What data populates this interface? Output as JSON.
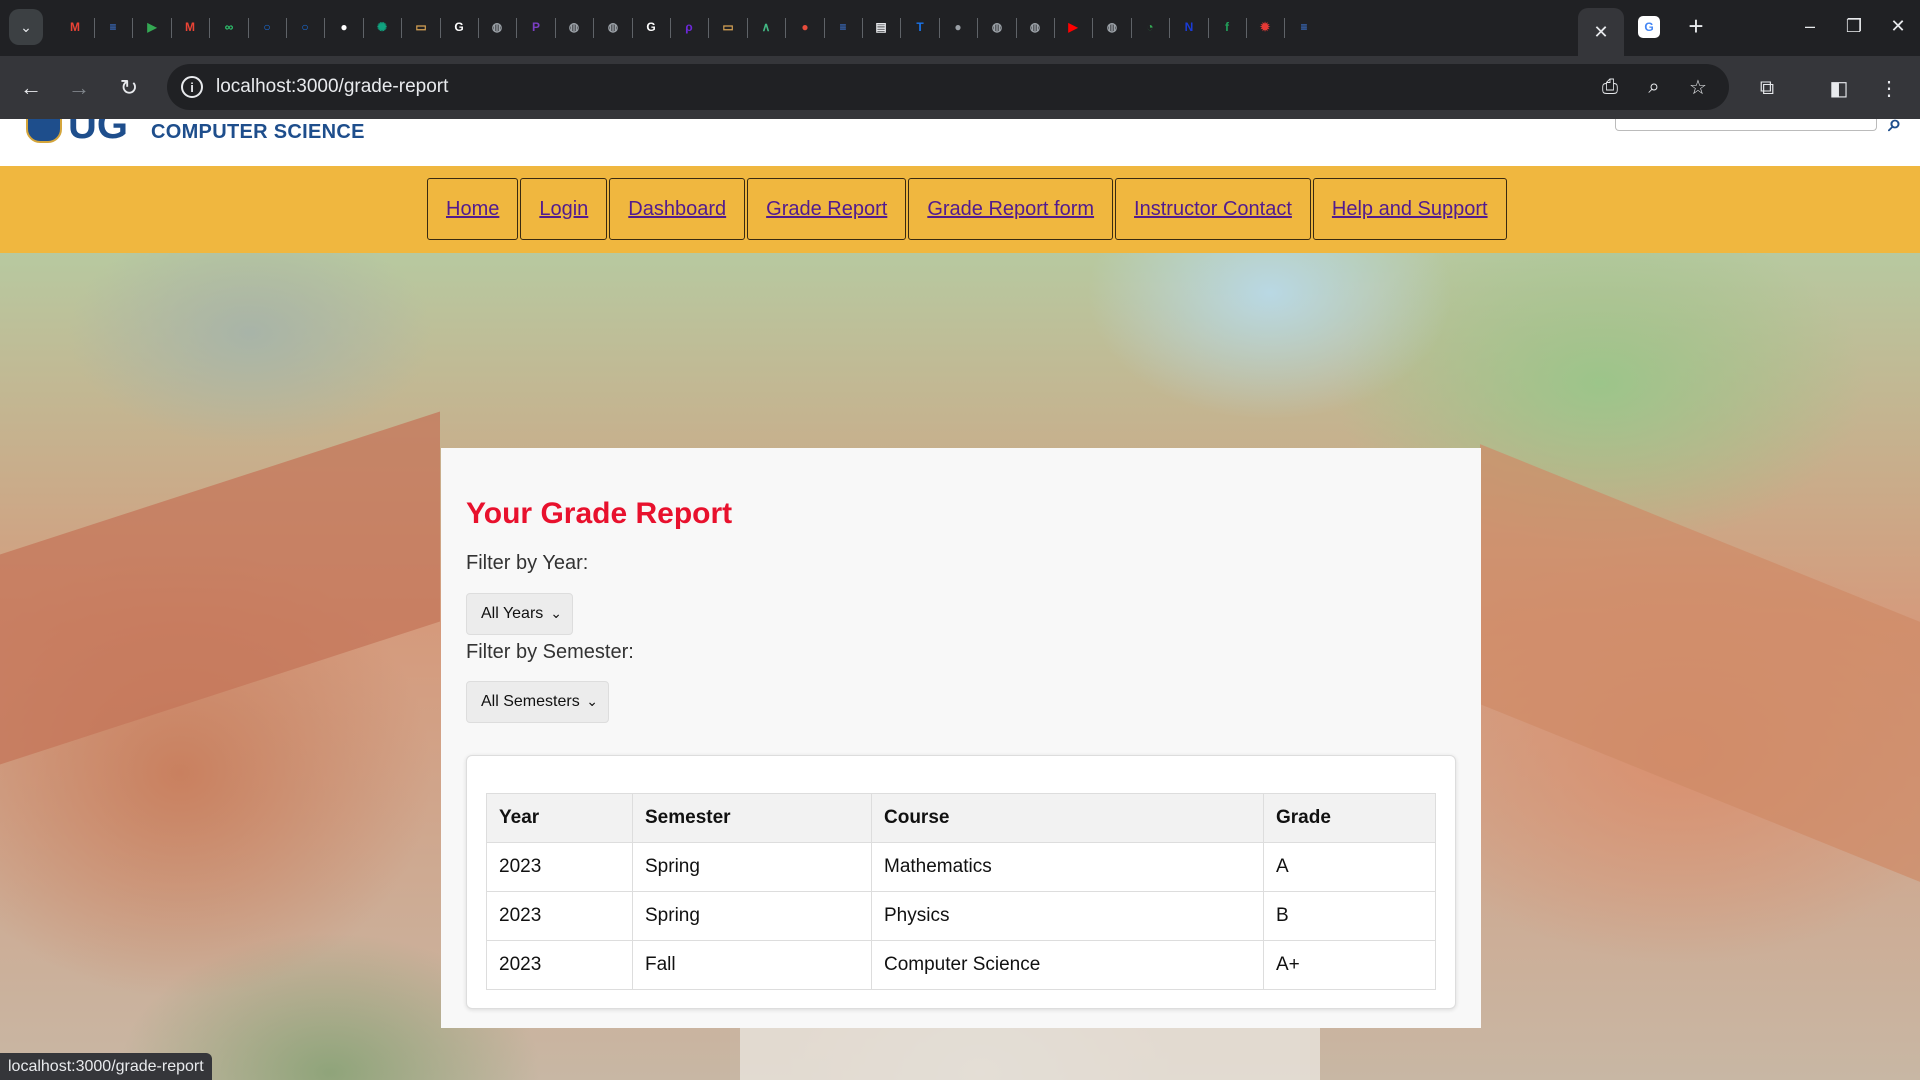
{
  "browser": {
    "tabs": [
      {
        "icon": "tab-search-icon"
      },
      {
        "icon": "gmail-icon",
        "color": "#ea4335"
      },
      {
        "icon": "docs-icon",
        "color": "#4285f4"
      },
      {
        "icon": "play-icon",
        "color": "#34a853"
      },
      {
        "icon": "gmail-icon",
        "color": "#ea4335"
      },
      {
        "icon": "link-icon",
        "color": "#2ecc71"
      },
      {
        "icon": "ring-icon",
        "color": "#1a73e8"
      },
      {
        "icon": "ring-icon",
        "color": "#1a73e8"
      },
      {
        "icon": "github-icon",
        "color": "#ffffff"
      },
      {
        "icon": "chatgpt-icon",
        "color": "#10a37f"
      },
      {
        "icon": "image-icon",
        "color": "#d4a053"
      },
      {
        "icon": "google-icon",
        "color": "#ffffff"
      },
      {
        "icon": "globe-icon",
        "color": "#9aa0a6"
      },
      {
        "icon": "p-icon",
        "color": "#7b3fc4"
      },
      {
        "icon": "globe-icon",
        "color": "#9aa0a6"
      },
      {
        "icon": "globe-icon",
        "color": "#9aa0a6"
      },
      {
        "icon": "google-icon",
        "color": "#ffffff"
      },
      {
        "icon": "p-stylized-icon",
        "color": "#6d28d9"
      },
      {
        "icon": "image-icon",
        "color": "#d4a053"
      },
      {
        "icon": "vue-icon",
        "color": "#42b883"
      },
      {
        "icon": "pill-icon",
        "color": "#e74c3c"
      },
      {
        "icon": "docs-icon",
        "color": "#4285f4"
      },
      {
        "icon": "newspaper-icon",
        "color": "#e8eaed"
      },
      {
        "icon": "tt-icon",
        "color": "#1a73e8"
      },
      {
        "icon": "apple-icon",
        "color": "#9aa0a6"
      },
      {
        "icon": "globe-icon",
        "color": "#9aa0a6"
      },
      {
        "icon": "globe-icon",
        "color": "#9aa0a6"
      },
      {
        "icon": "youtube-icon",
        "color": "#ff0000"
      },
      {
        "icon": "globe-icon",
        "color": "#9aa0a6"
      },
      {
        "icon": "spinner-icon",
        "color": "#34a853"
      },
      {
        "icon": "n-icon",
        "color": "#1a3bd6"
      },
      {
        "icon": "f-icon",
        "color": "#22a05a"
      },
      {
        "icon": "gear-red-icon",
        "color": "#e53935"
      },
      {
        "icon": "docs-icon",
        "color": "#4285f4"
      }
    ],
    "active_tab_close": "✕",
    "url": "localhost:3000/grade-report",
    "status_url": "localhost:3000/grade-report"
  },
  "site": {
    "logo_initials": "UG",
    "logo_subtitle": "COMPUTER SCIENCE",
    "nav": [
      "Home",
      "Login",
      "Dashboard",
      "Grade Report",
      "Grade Report form",
      "Instructor Contact",
      "Help and Support"
    ]
  },
  "report": {
    "title": "Your Grade Report",
    "year_label": "Filter by Year:",
    "year_value": "All Years",
    "semester_label": "Filter by Semester:",
    "semester_value": "All Semesters",
    "columns": [
      "Year",
      "Semester",
      "Course",
      "Grade"
    ],
    "rows": [
      [
        "2023",
        "Spring",
        "Mathematics",
        "A"
      ],
      [
        "2023",
        "Spring",
        "Physics",
        "B"
      ],
      [
        "2023",
        "Fall",
        "Computer Science",
        "A+"
      ]
    ]
  },
  "colors": {
    "nav_bar": "#f0b73f",
    "title_red": "#e8112d",
    "brand_blue": "#1e4e8c",
    "link_purple": "#521b8f"
  }
}
